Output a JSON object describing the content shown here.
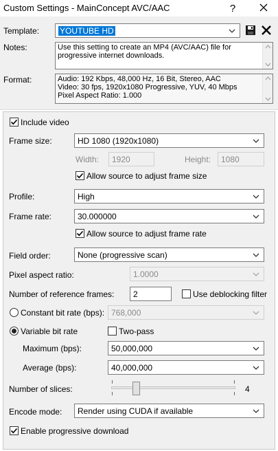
{
  "window": {
    "title": "Custom Settings - MainConcept AVC/AAC",
    "help_label": "?",
    "close_label": "✕"
  },
  "template": {
    "label": "Template:",
    "value": "YOUTUBE HD"
  },
  "notes": {
    "label": "Notes:",
    "lines": [
      "Use this setting to create an MP4 (AVC/AAC) file for",
      "progressive internet downloads."
    ]
  },
  "format": {
    "label": "Format:",
    "lines": [
      "Audio: 192 Kbps, 48,000 Hz, 16 Bit, Stereo, AAC",
      "Video: 30 fps, 1920x1080 Progressive, YUV, 40 Mbps",
      "Pixel Aspect Ratio: 1.000"
    ]
  },
  "video": {
    "include_video": {
      "label": "Include video",
      "checked": true
    },
    "frame_size": {
      "label": "Frame size:",
      "value": "HD 1080 (1920x1080)"
    },
    "width": {
      "label": "Width:",
      "value": "1920"
    },
    "height": {
      "label": "Height:",
      "value": "1080"
    },
    "allow_adjust_size": {
      "label": "Allow source to adjust frame size",
      "checked": true
    },
    "profile": {
      "label": "Profile:",
      "value": "High"
    },
    "frame_rate": {
      "label": "Frame rate:",
      "value": "30.000000"
    },
    "allow_adjust_rate": {
      "label": "Allow source to adjust frame rate",
      "checked": true
    },
    "field_order": {
      "label": "Field order:",
      "value": "None (progressive scan)"
    },
    "pixel_aspect": {
      "label": "Pixel aspect ratio:",
      "value": "1.0000"
    },
    "ref_frames": {
      "label": "Number of reference frames:",
      "value": "2"
    },
    "deblocking": {
      "label": "Use deblocking filter",
      "checked": false
    },
    "constant_bitrate": {
      "label": "Constant bit rate (bps):",
      "value": "768,000",
      "selected": false
    },
    "variable_bitrate": {
      "label": "Variable bit rate",
      "selected": true
    },
    "two_pass": {
      "label": "Two-pass",
      "checked": false
    },
    "maximum": {
      "label": "Maximum (bps):",
      "value": "50,000,000"
    },
    "average": {
      "label": "Average (bps):",
      "value": "40,000,000"
    },
    "slices": {
      "label": "Number of slices:",
      "value": "4",
      "min": 1,
      "max": 16,
      "current": 4
    },
    "encode_mode": {
      "label": "Encode mode:",
      "value": "Render using CUDA if available"
    },
    "progressive_download": {
      "label": "Enable progressive download",
      "checked": true
    }
  }
}
